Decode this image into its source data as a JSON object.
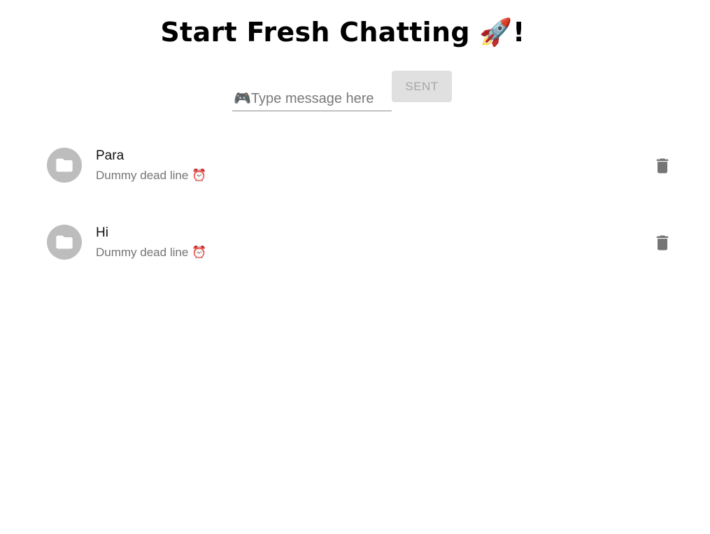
{
  "header": {
    "title": "Start Fresh Chatting 🚀!"
  },
  "composer": {
    "placeholder": "🎮Type message here",
    "value": "",
    "send_label": "SENT"
  },
  "chats": [
    {
      "title": "Para",
      "subtitle": "Dummy dead line ⏰",
      "avatar_icon": "folder-icon",
      "action_icon": "trash-icon"
    },
    {
      "title": "Hi",
      "subtitle": "Dummy dead line ⏰",
      "avatar_icon": "folder-icon",
      "action_icon": "trash-icon"
    }
  ],
  "colors": {
    "avatar_bg": "#bdbdbd",
    "icon_fill": "#757575",
    "button_disabled_bg": "#e0e0e0",
    "button_disabled_text": "#a6a6a6"
  }
}
